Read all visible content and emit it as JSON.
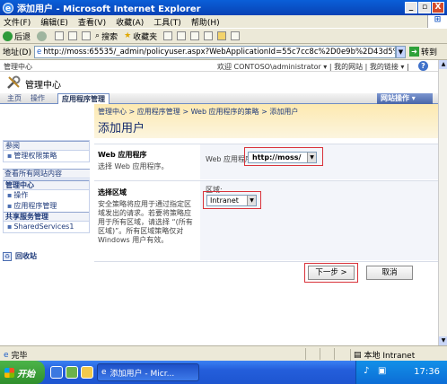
{
  "window": {
    "title": "添加用户 - Microsoft Internet Explorer",
    "min": "_",
    "max": "▫",
    "close": "X",
    "icon": "e"
  },
  "menu": [
    "文件(F)",
    "编辑(E)",
    "查看(V)",
    "收藏(A)",
    "工具(T)",
    "帮助(H)"
  ],
  "toolbar": {
    "back": "后退",
    "search": "搜索",
    "favorites": "收藏夹"
  },
  "address": {
    "label": "地址(D)",
    "url": "http://moss:65535/_admin/policyuser.aspx?WebApplicationId=55c7cc8c%2D0e9b%2D43d5%2Db66f",
    "go": "转到"
  },
  "sp": {
    "site_name": "管理中心",
    "user_links": "欢迎 CONTOSO\\administrator ▾  |  我的网站  |  我的链接 ▾  |",
    "help": "?",
    "header_title": "管理中心",
    "tabs": [
      "主页",
      "操作",
      "应用程序管理"
    ],
    "site_actions": "网站操作 ▾"
  },
  "leftnav": {
    "view_all_top": "参阅",
    "link_policy": "管理权限策略",
    "view_all": "查看所有网站内容",
    "central_admin": "管理中心",
    "operations": "操作",
    "app_mgmt": "应用程序管理",
    "shared_services": "共享服务管理",
    "ssp": "SharedServices1",
    "recycle_bin": "回收站"
  },
  "page": {
    "breadcrumb": "管理中心 > 应用程序管理 > Web 应用程序的策略 > 添加用户",
    "title": "添加用户",
    "section1_heading": "Web 应用程序",
    "section1_desc": "选择 Web 应用程序。",
    "webapp_label": "Web 应用程序:",
    "webapp_value": "http://moss/",
    "section2_heading": "选择区域",
    "section2_desc": "安全策略将应用于通过指定区域发出的请求。若要将策略应用于所有区域，请选择 “(所有区域)”。所有区域策略仅对 Windows 用户有效。",
    "zone_label": "区域:",
    "zone_value": "Intranet",
    "next_button": "下一步 >",
    "cancel_button": "取消"
  },
  "status": {
    "done": "完毕",
    "zone": "本地 Intranet"
  },
  "taskbar": {
    "start": "开始",
    "task": "添加用户 - Micr...",
    "clock": "17:36"
  }
}
